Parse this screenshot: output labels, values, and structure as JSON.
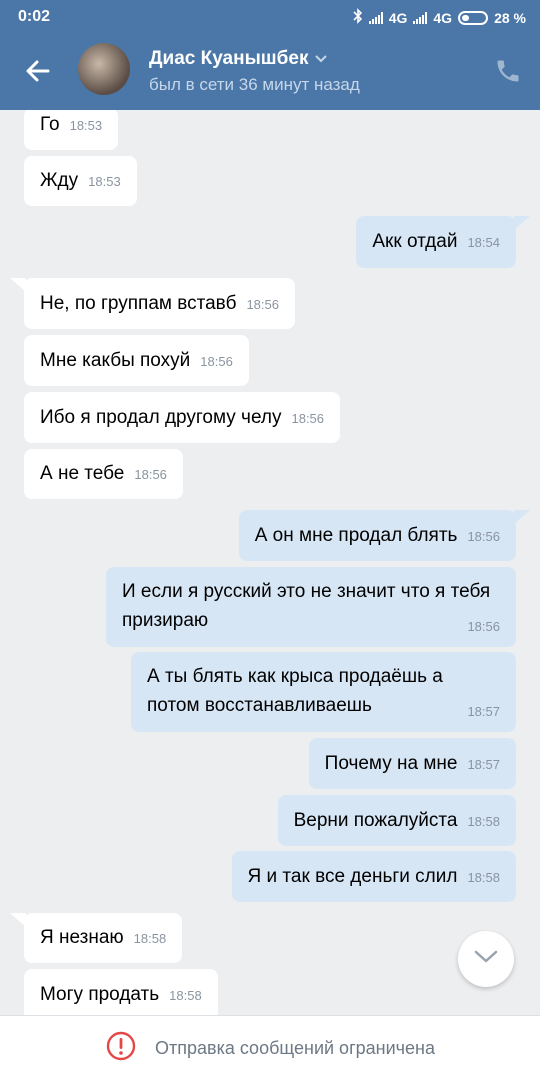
{
  "status_bar": {
    "time": "0:02",
    "network1": "4G",
    "network2": "4G",
    "battery": "28 %"
  },
  "header": {
    "contact_name": "Диас Куанышбек",
    "contact_status": "был в сети 36 минут назад",
    "icons": {
      "back": "back-arrow-icon",
      "dropdown": "chevron-down-icon",
      "call": "phone-icon"
    }
  },
  "messages": [
    {
      "dir": "in",
      "text": "Го",
      "time": "18:53"
    },
    {
      "dir": "in",
      "text": "Жду",
      "time": "18:53"
    },
    {
      "dir": "out",
      "text": "Акк отдай",
      "time": "18:54"
    },
    {
      "dir": "in",
      "text": "Не, по группам вставб",
      "time": "18:56"
    },
    {
      "dir": "in",
      "text": "Мне какбы похуй",
      "time": "18:56"
    },
    {
      "dir": "in",
      "text": "Ибо я продал другому челу",
      "time": "18:56"
    },
    {
      "dir": "in",
      "text": "А не тебе",
      "time": "18:56"
    },
    {
      "dir": "out",
      "text": "А он мне продал блять",
      "time": "18:56"
    },
    {
      "dir": "out",
      "text": "И если я русский это не значит что я тебя призираю",
      "time": "18:56"
    },
    {
      "dir": "out",
      "text": "А ты блять как крыса продаёшь а потом восстанавливаешь",
      "time": "18:57"
    },
    {
      "dir": "out",
      "text": "Почему на мне",
      "time": "18:57"
    },
    {
      "dir": "out",
      "text": "Верни пожалуйста",
      "time": "18:58"
    },
    {
      "dir": "out",
      "text": "Я и так все деньги слил",
      "time": "18:58"
    },
    {
      "dir": "in",
      "text": "Я незнаю",
      "time": "18:58"
    },
    {
      "dir": "in",
      "text": "Могу продать",
      "time": "18:58"
    }
  ],
  "bottom_bar": {
    "label": "Отправка сообщений ограничена",
    "icon": "alert-circle-icon",
    "accent": "#e64646"
  },
  "colors": {
    "header_bg": "#4a76a8",
    "chat_bg": "#edeef0",
    "incoming_bubble": "#ffffff",
    "outgoing_bubble": "#d7e6f5"
  }
}
